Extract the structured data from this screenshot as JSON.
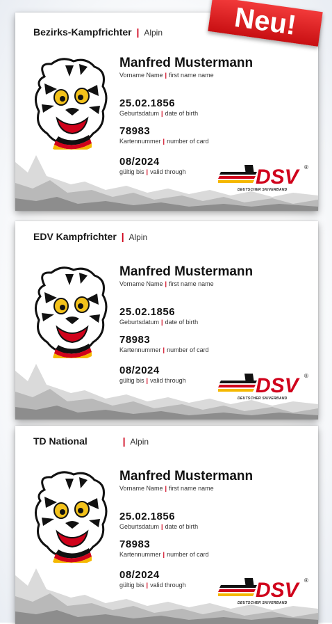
{
  "badge": {
    "label": "Neu!",
    "color": "#e01e22"
  },
  "cards": [
    {
      "role": "Bezirks-Kampfrichter",
      "separator": "|",
      "discipline": "Alpin",
      "name": "Manfred Mustermann",
      "name_label": "Vorname Name",
      "name_label_en": "first name name",
      "dob": "25.02.1856",
      "dob_label": "Geburtsdatum",
      "dob_label_en": "date of birth",
      "card_number": "78983",
      "card_number_label": "Kartennummer",
      "card_number_label_en": "number of card",
      "valid": "08/2024",
      "valid_label": "gültig bis",
      "valid_label_en": "valid through",
      "logo_text": "DSV",
      "logo_sub": "DEUTSCHER SKIVERBAND"
    },
    {
      "role": "EDV Kampfrichter",
      "separator": "|",
      "discipline": "Alpin",
      "name": "Manfred Mustermann",
      "name_label": "Vorname Name",
      "name_label_en": "first name name",
      "dob": "25.02.1856",
      "dob_label": "Geburtsdatum",
      "dob_label_en": "date of birth",
      "card_number": "78983",
      "card_number_label": "Kartennummer",
      "card_number_label_en": "number of card",
      "valid": "08/2024",
      "valid_label": "gültig bis",
      "valid_label_en": "valid through",
      "logo_text": "DSV",
      "logo_sub": "DEUTSCHER SKIVERBAND"
    },
    {
      "role": "TD National",
      "separator": "|",
      "discipline": "Alpin",
      "name": "Manfred Mustermann",
      "name_label": "Vorname Name",
      "name_label_en": "first name name",
      "dob": "25.02.1856",
      "dob_label": "Geburtsdatum",
      "dob_label_en": "date of birth",
      "card_number": "78983",
      "card_number_label": "Kartennummer",
      "card_number_label_en": "number of card",
      "valid": "08/2024",
      "valid_label": "gültig bis",
      "valid_label_en": "valid through",
      "logo_text": "DSV",
      "logo_sub": "DEUTSCHER SKIVERBAND"
    }
  ],
  "colors": {
    "accent_red": "#d0021b",
    "flag_black": "#111111",
    "flag_red": "#d0021b",
    "flag_gold": "#f5b800",
    "mountain_gray": "#9a9a9a"
  },
  "icons": [
    "tiger-mascot-icon",
    "dsv-logo-icon",
    "mountain-silhouette-icon"
  ]
}
